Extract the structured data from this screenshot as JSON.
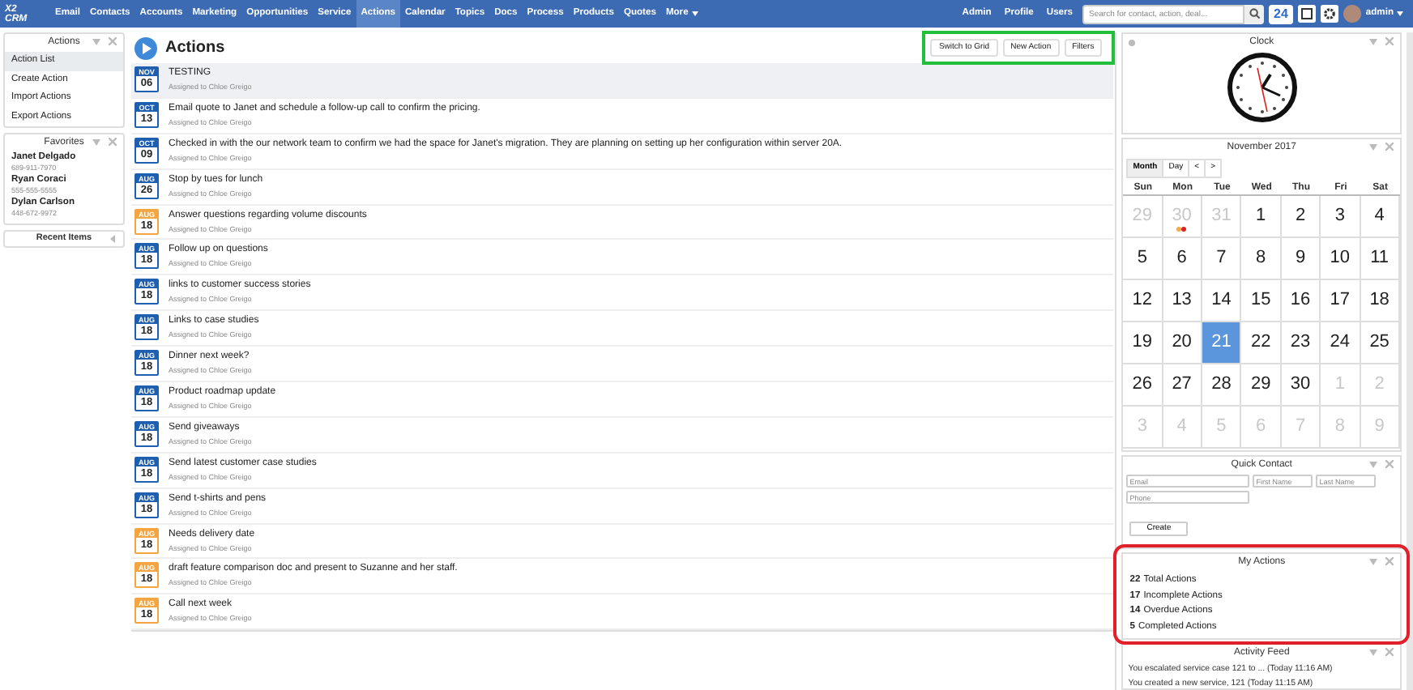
{
  "nav": {
    "logo": "X2 CRM",
    "items": [
      {
        "label": "Email",
        "selected": false
      },
      {
        "label": "Contacts",
        "selected": false
      },
      {
        "label": "Accounts",
        "selected": false
      },
      {
        "label": "Marketing",
        "selected": false
      },
      {
        "label": "Opportunities",
        "selected": false
      },
      {
        "label": "Service",
        "selected": false
      },
      {
        "label": "Actions",
        "selected": true
      },
      {
        "label": "Calendar",
        "selected": false
      },
      {
        "label": "Topics",
        "selected": false
      },
      {
        "label": "Docs",
        "selected": false
      },
      {
        "label": "Process",
        "selected": false
      },
      {
        "label": "Products",
        "selected": false
      },
      {
        "label": "Quotes",
        "selected": false
      },
      {
        "label": "More",
        "selected": false
      }
    ],
    "right_links": [
      "Admin",
      "Profile",
      "Users"
    ],
    "search": {
      "placeholder": "Search for contact, action, deal..."
    },
    "notification_count": "24",
    "user": "admin"
  },
  "sidebar": {
    "actions_panel": {
      "title": "Actions",
      "items": [
        {
          "label": "Action List",
          "selected": true
        },
        {
          "label": "Create Action",
          "selected": false
        },
        {
          "label": "Import Actions",
          "selected": false
        },
        {
          "label": "Export Actions",
          "selected": false
        }
      ]
    },
    "favorites": {
      "title": "Favorites",
      "contacts": [
        {
          "name": "Janet Delgado",
          "phone": "689-911-7970"
        },
        {
          "name": "Ryan Coraci",
          "phone": "555-555-5555"
        },
        {
          "name": "Dylan Carlson",
          "phone": "448-672-9972"
        }
      ]
    },
    "recent_items": {
      "title": "Recent Items"
    }
  },
  "main": {
    "title": "Actions",
    "buttons": [
      "Switch to Grid",
      "New Action",
      "Filters"
    ],
    "actions": [
      {
        "month": "NOV",
        "day": "06",
        "title": "TESTING",
        "assigned": "Assigned to Chloe Greigo",
        "color": "#1f5fb0",
        "selected": true
      },
      {
        "month": "OCT",
        "day": "13",
        "title": "Email quote to Janet and schedule a follow-up call to confirm the pricing.",
        "assigned": "Assigned to Chloe Greigo",
        "color": "#1f5fb0",
        "selected": false
      },
      {
        "month": "OCT",
        "day": "09",
        "title": "Checked in with the our network team to confirm we had the space for Janet's migration. They are planning on setting up her configuration within server 20A.",
        "assigned": "Assigned to Chloe Greigo",
        "color": "#1f5fb0",
        "selected": false
      },
      {
        "month": "AUG",
        "day": "26",
        "title": "Stop by tues for lunch",
        "assigned": "Assigned to Chloe Greigo",
        "color": "#1f5fb0",
        "selected": false
      },
      {
        "month": "AUG",
        "day": "18",
        "title": "Answer questions regarding volume discounts",
        "assigned": "Assigned to Chloe Greigo",
        "color": "#f5a540",
        "selected": false
      },
      {
        "month": "AUG",
        "day": "18",
        "title": "Follow up on questions",
        "assigned": "Assigned to Chloe Greigo",
        "color": "#1f5fb0",
        "selected": false
      },
      {
        "month": "AUG",
        "day": "18",
        "title": "links to customer success stories",
        "assigned": "Assigned to Chloe Greigo",
        "color": "#1f5fb0",
        "selected": false
      },
      {
        "month": "AUG",
        "day": "18",
        "title": "Links to case studies",
        "assigned": "Assigned to Chloe Greigo",
        "color": "#1f5fb0",
        "selected": false
      },
      {
        "month": "AUG",
        "day": "18",
        "title": "Dinner next week?",
        "assigned": "Assigned to Chloe Greigo",
        "color": "#1f5fb0",
        "selected": false
      },
      {
        "month": "AUG",
        "day": "18",
        "title": "Product roadmap update",
        "assigned": "Assigned to Chloe Greigo",
        "color": "#1f5fb0",
        "selected": false
      },
      {
        "month": "AUG",
        "day": "18",
        "title": "Send giveaways",
        "assigned": "Assigned to Chloe Greigo",
        "color": "#1f5fb0",
        "selected": false
      },
      {
        "month": "AUG",
        "day": "18",
        "title": "Send latest customer case studies",
        "assigned": "Assigned to Chloe Greigo",
        "color": "#1f5fb0",
        "selected": false
      },
      {
        "month": "AUG",
        "day": "18",
        "title": "Send t-shirts and pens",
        "assigned": "Assigned to Chloe Greigo",
        "color": "#1f5fb0",
        "selected": false
      },
      {
        "month": "AUG",
        "day": "18",
        "title": "Needs delivery date",
        "assigned": "Assigned to Chloe Greigo",
        "color": "#f5a540",
        "selected": false
      },
      {
        "month": "AUG",
        "day": "18",
        "title": "draft feature comparison doc and present to Suzanne and her staff.",
        "assigned": "Assigned to Chloe Greigo",
        "color": "#f5a540",
        "selected": false
      },
      {
        "month": "AUG",
        "day": "18",
        "title": "Call next week",
        "assigned": "Assigned to Chloe Greigo",
        "color": "#f5a540",
        "selected": false
      }
    ]
  },
  "right": {
    "clock": {
      "title": "Clock"
    },
    "calendar": {
      "title": "November 2017",
      "views": [
        {
          "label": "Month",
          "selected": true
        },
        {
          "label": "Day",
          "selected": false
        }
      ],
      "prev": "<",
      "next": ">",
      "weekdays": [
        "Sun",
        "Mon",
        "Tue",
        "Wed",
        "Thu",
        "Fri",
        "Sat"
      ],
      "weeks": [
        [
          {
            "day": "29",
            "muted": true,
            "selected": false
          },
          {
            "day": "30",
            "muted": true,
            "selected": false,
            "events": [
              {
                "color": "#f0ad4e"
              },
              {
                "color": "#e02020"
              }
            ]
          },
          {
            "day": "31",
            "muted": true,
            "selected": false
          },
          {
            "day": "1",
            "muted": false,
            "selected": false
          },
          {
            "day": "2",
            "muted": false,
            "selected": false
          },
          {
            "day": "3",
            "muted": false,
            "selected": false
          },
          {
            "day": "4",
            "muted": false,
            "selected": false
          }
        ],
        [
          {
            "day": "5",
            "muted": false,
            "selected": false
          },
          {
            "day": "6",
            "muted": false,
            "selected": false
          },
          {
            "day": "7",
            "muted": false,
            "selected": false
          },
          {
            "day": "8",
            "muted": false,
            "selected": false
          },
          {
            "day": "9",
            "muted": false,
            "selected": false
          },
          {
            "day": "10",
            "muted": false,
            "selected": false
          },
          {
            "day": "11",
            "muted": false,
            "selected": false
          }
        ],
        [
          {
            "day": "12",
            "muted": false,
            "selected": false
          },
          {
            "day": "13",
            "muted": false,
            "selected": false
          },
          {
            "day": "14",
            "muted": false,
            "selected": false
          },
          {
            "day": "15",
            "muted": false,
            "selected": false
          },
          {
            "day": "16",
            "muted": false,
            "selected": false
          },
          {
            "day": "17",
            "muted": false,
            "selected": false
          },
          {
            "day": "18",
            "muted": false,
            "selected": false
          }
        ],
        [
          {
            "day": "19",
            "muted": false,
            "selected": false
          },
          {
            "day": "20",
            "muted": false,
            "selected": false
          },
          {
            "day": "21",
            "muted": false,
            "selected": true
          },
          {
            "day": "22",
            "muted": false,
            "selected": false
          },
          {
            "day": "23",
            "muted": false,
            "selected": false
          },
          {
            "day": "24",
            "muted": false,
            "selected": false
          },
          {
            "day": "25",
            "muted": false,
            "selected": false
          }
        ],
        [
          {
            "day": "26",
            "muted": false,
            "selected": false
          },
          {
            "day": "27",
            "muted": false,
            "selected": false
          },
          {
            "day": "28",
            "muted": false,
            "selected": false
          },
          {
            "day": "29",
            "muted": false,
            "selected": false
          },
          {
            "day": "30",
            "muted": false,
            "selected": false
          },
          {
            "day": "1",
            "muted": true,
            "selected": false
          },
          {
            "day": "2",
            "muted": true,
            "selected": false
          }
        ],
        [
          {
            "day": "3",
            "muted": true,
            "selected": false
          },
          {
            "day": "4",
            "muted": true,
            "selected": false
          },
          {
            "day": "5",
            "muted": true,
            "selected": false
          },
          {
            "day": "6",
            "muted": true,
            "selected": false
          },
          {
            "day": "7",
            "muted": true,
            "selected": false
          },
          {
            "day": "8",
            "muted": true,
            "selected": false
          },
          {
            "day": "9",
            "muted": true,
            "selected": false
          }
        ]
      ]
    },
    "quick_contact": {
      "title": "Quick Contact",
      "fields": [
        {
          "placeholder": "Email"
        },
        {
          "placeholder": "First Name"
        },
        {
          "placeholder": "Last Name"
        },
        {
          "placeholder": "Phone"
        }
      ],
      "button": "Create"
    },
    "my_actions": {
      "title": "My Actions",
      "stats": [
        {
          "count": "22",
          "label": "Total Actions"
        },
        {
          "count": "17",
          "label": "Incomplete Actions"
        },
        {
          "count": "14",
          "label": "Overdue Actions"
        },
        {
          "count": "5",
          "label": "Completed Actions"
        }
      ]
    },
    "activity_feed": {
      "title": "Activity Feed",
      "entries": [
        "You escalated service case 121 to ... (Today 11:16 AM)",
        "You created a new service, 121 (Today 11:15 AM)"
      ]
    }
  }
}
